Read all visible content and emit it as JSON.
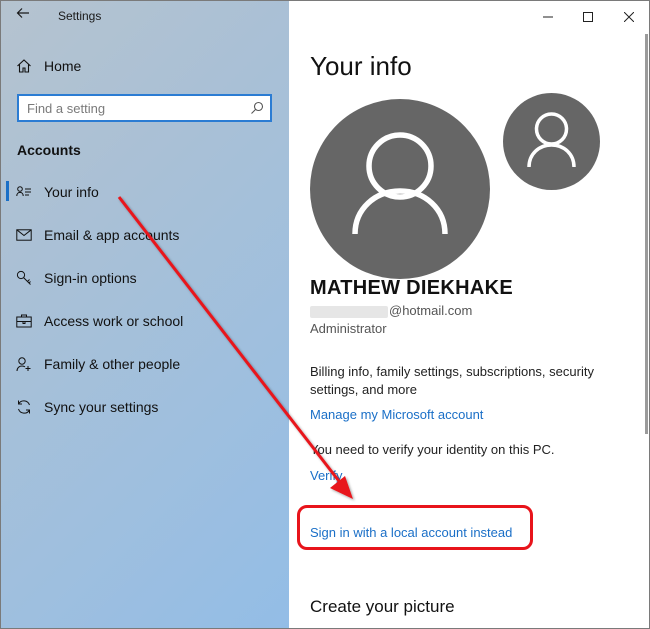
{
  "window": {
    "title": "Settings",
    "controls": [
      "—",
      "☐",
      "✕"
    ]
  },
  "sidebar": {
    "home_label": "Home",
    "search_placeholder": "Find a setting",
    "section_title": "Accounts",
    "items": [
      {
        "label": "Your info",
        "icon": "person-card-icon",
        "active": true
      },
      {
        "label": "Email & app accounts",
        "icon": "mail-icon"
      },
      {
        "label": "Sign-in options",
        "icon": "key-icon"
      },
      {
        "label": "Access work or school",
        "icon": "briefcase-icon"
      },
      {
        "label": "Family & other people",
        "icon": "person-add-icon"
      },
      {
        "label": "Sync your settings",
        "icon": "sync-icon"
      }
    ]
  },
  "main": {
    "title": "Your info",
    "user_name": "MATHEW DIEKHAKE",
    "email_domain": "@hotmail.com",
    "role": "Administrator",
    "billing_text": "Billing info, family settings, subscriptions, security settings, and more",
    "manage_link": "Manage my Microsoft account",
    "verify_text": "You need to verify your identity on this PC.",
    "verify_link": "Verify",
    "local_account_link": "Sign in with a local account instead",
    "create_picture_heading": "Create your picture"
  },
  "colors": {
    "accent": "#1a6fc7",
    "annotation": "#e8141b",
    "avatar": "#666666"
  }
}
